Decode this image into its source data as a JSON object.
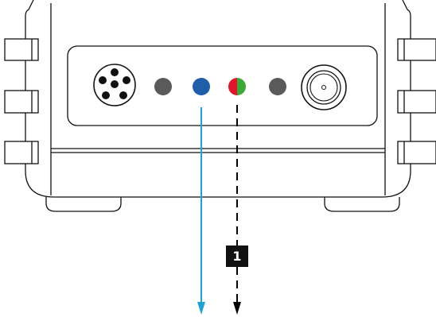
{
  "diagram": {
    "callouts": [
      {
        "number": "1"
      }
    ],
    "indicators": [
      {
        "id": "led-1",
        "state": "off",
        "color": "#5a5a5a"
      },
      {
        "id": "led-2",
        "state": "blue",
        "color": "#1f5ea8"
      },
      {
        "id": "led-3",
        "state": "red-green",
        "color_left": "#e2162a",
        "color_right": "#3aa935"
      },
      {
        "id": "led-4",
        "state": "off",
        "color": "#5a5a5a"
      }
    ],
    "arrows": [
      {
        "id": "arrow-blue",
        "style": "solid",
        "color": "#1aa3d9",
        "from_indicator": "led-2"
      },
      {
        "id": "arrow-dashed",
        "style": "dashed",
        "color": "#000000",
        "from_indicator": "led-3"
      }
    ],
    "colors": {
      "outline": "#111111",
      "callout_bg": "#111111",
      "callout_text": "#ffffff",
      "led_off": "#5a5a5a",
      "led_blue": "#1f5ea8",
      "led_red": "#e2162a",
      "led_green": "#3aa935",
      "arrow_blue": "#1aa3d9"
    }
  }
}
